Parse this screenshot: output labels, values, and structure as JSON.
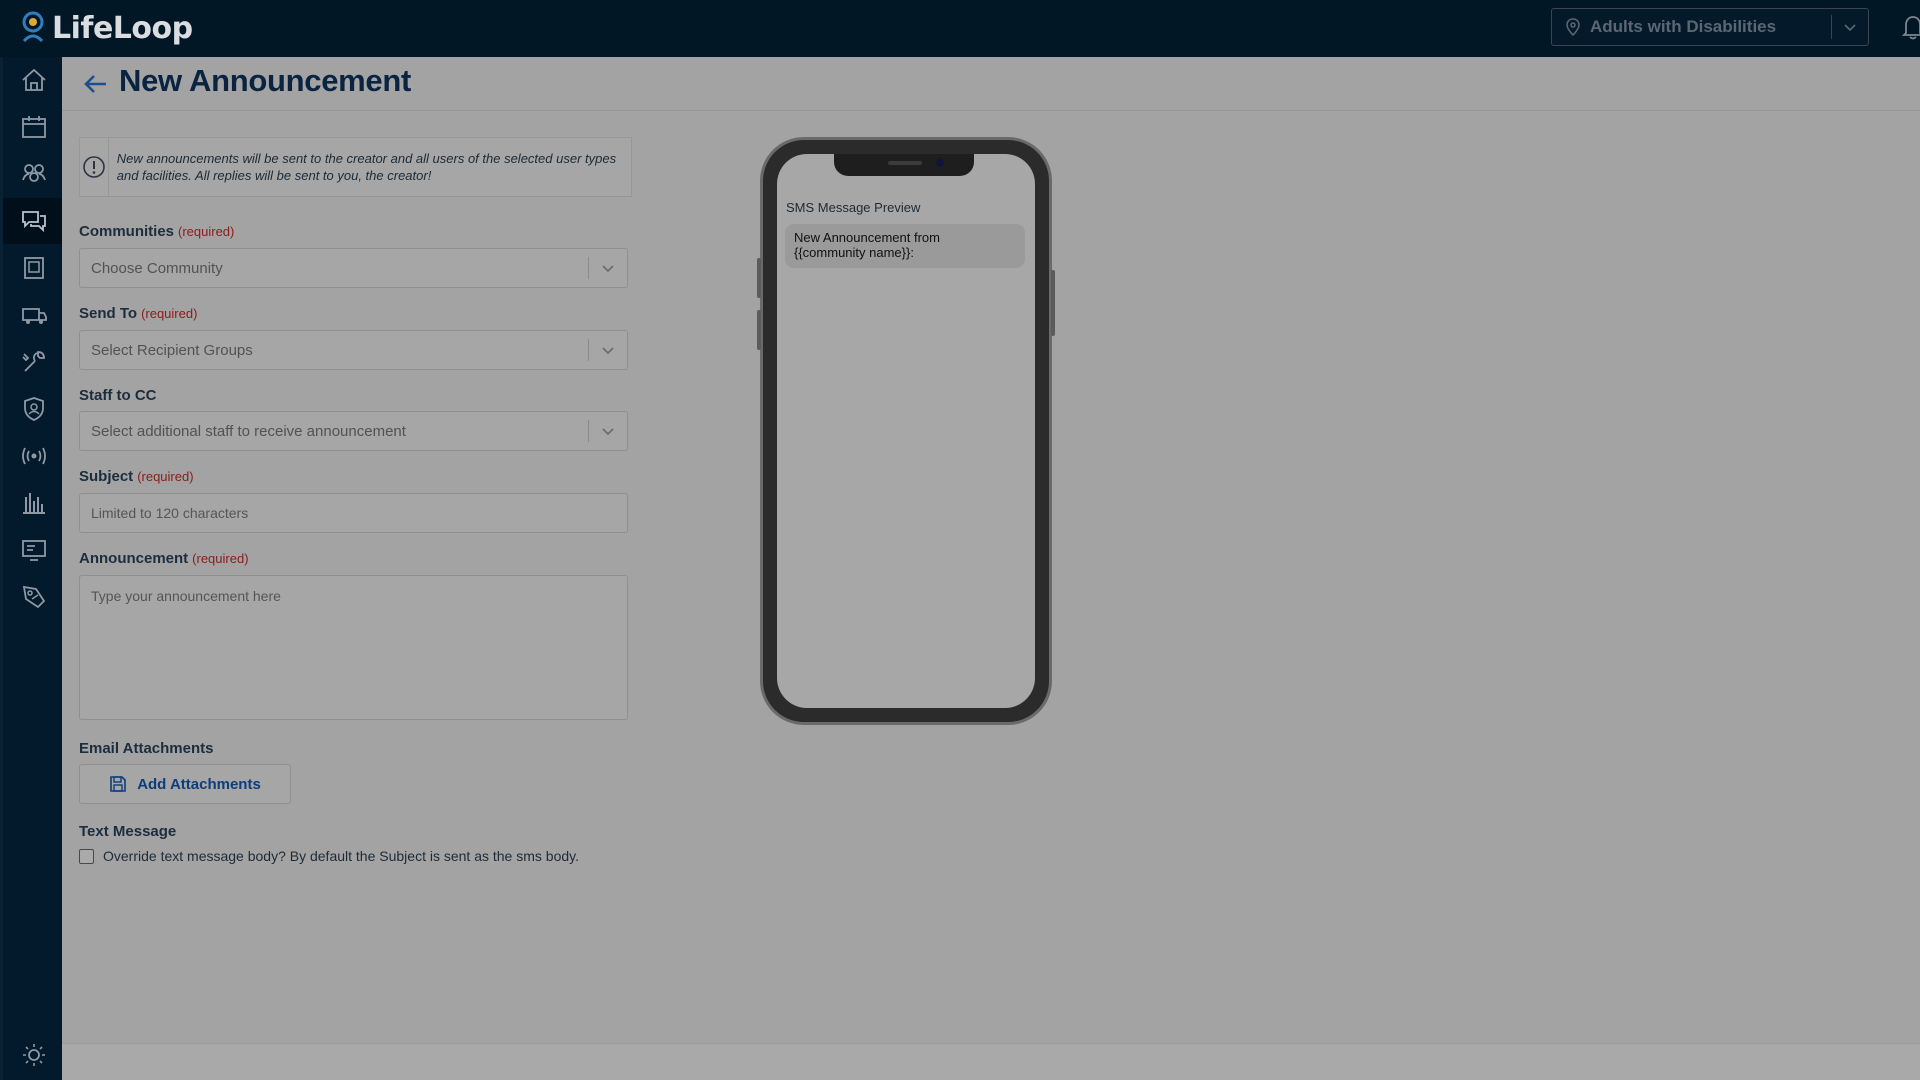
{
  "app": {
    "brand": "LifeLoop"
  },
  "topbar": {
    "community_value": "Adults with Disabilities"
  },
  "sidebar": {
    "items": [
      {
        "icon": "home-icon",
        "active": false
      },
      {
        "icon": "calendar-icon",
        "active": false
      },
      {
        "icon": "residents-icon",
        "active": false
      },
      {
        "icon": "messages-icon",
        "active": true
      },
      {
        "icon": "building-icon",
        "active": false
      },
      {
        "icon": "transport-icon",
        "active": false
      },
      {
        "icon": "maintenance-icon",
        "active": false
      },
      {
        "icon": "security-icon",
        "active": false
      },
      {
        "icon": "broadcast-icon",
        "active": false
      },
      {
        "icon": "reports-icon",
        "active": false
      },
      {
        "icon": "display-icon",
        "active": false
      },
      {
        "icon": "marketing-icon",
        "active": false
      }
    ],
    "bottom_icon": "lightbulb-icon"
  },
  "page": {
    "title": "New Announcement",
    "info": "New announcements will be sent to the creator and all users of the selected user types and facilities. All replies will be sent to you, the creator!"
  },
  "form": {
    "required_tag": "(required)",
    "communities": {
      "label": "Communities",
      "placeholder": "Choose Community"
    },
    "send_to": {
      "label": "Send To",
      "placeholder": "Select Recipient Groups"
    },
    "staff_cc": {
      "label": "Staff to CC",
      "placeholder": "Select additional staff to receive announcement"
    },
    "subject": {
      "label": "Subject",
      "placeholder": "Limited to 120 characters"
    },
    "announcement": {
      "label": "Announcement",
      "placeholder": "Type your announcement here"
    },
    "attachments": {
      "label": "Email Attachments",
      "button": "Add Attachments"
    },
    "text_message": {
      "label": "Text Message",
      "checkbox": "Override text message body? By default the Subject is sent as the sms body.",
      "checked": false
    }
  },
  "preview": {
    "title": "SMS Message Preview",
    "message_line1": "New Announcement from",
    "message_line2": "{{community name}}:"
  },
  "colors": {
    "topbar": "#021726",
    "sidebar": "#021a2c",
    "overlay_bg": "#a3a3a3",
    "title": "#0a2340",
    "required": "#8a1c1c",
    "link": "#0d3d7c"
  }
}
